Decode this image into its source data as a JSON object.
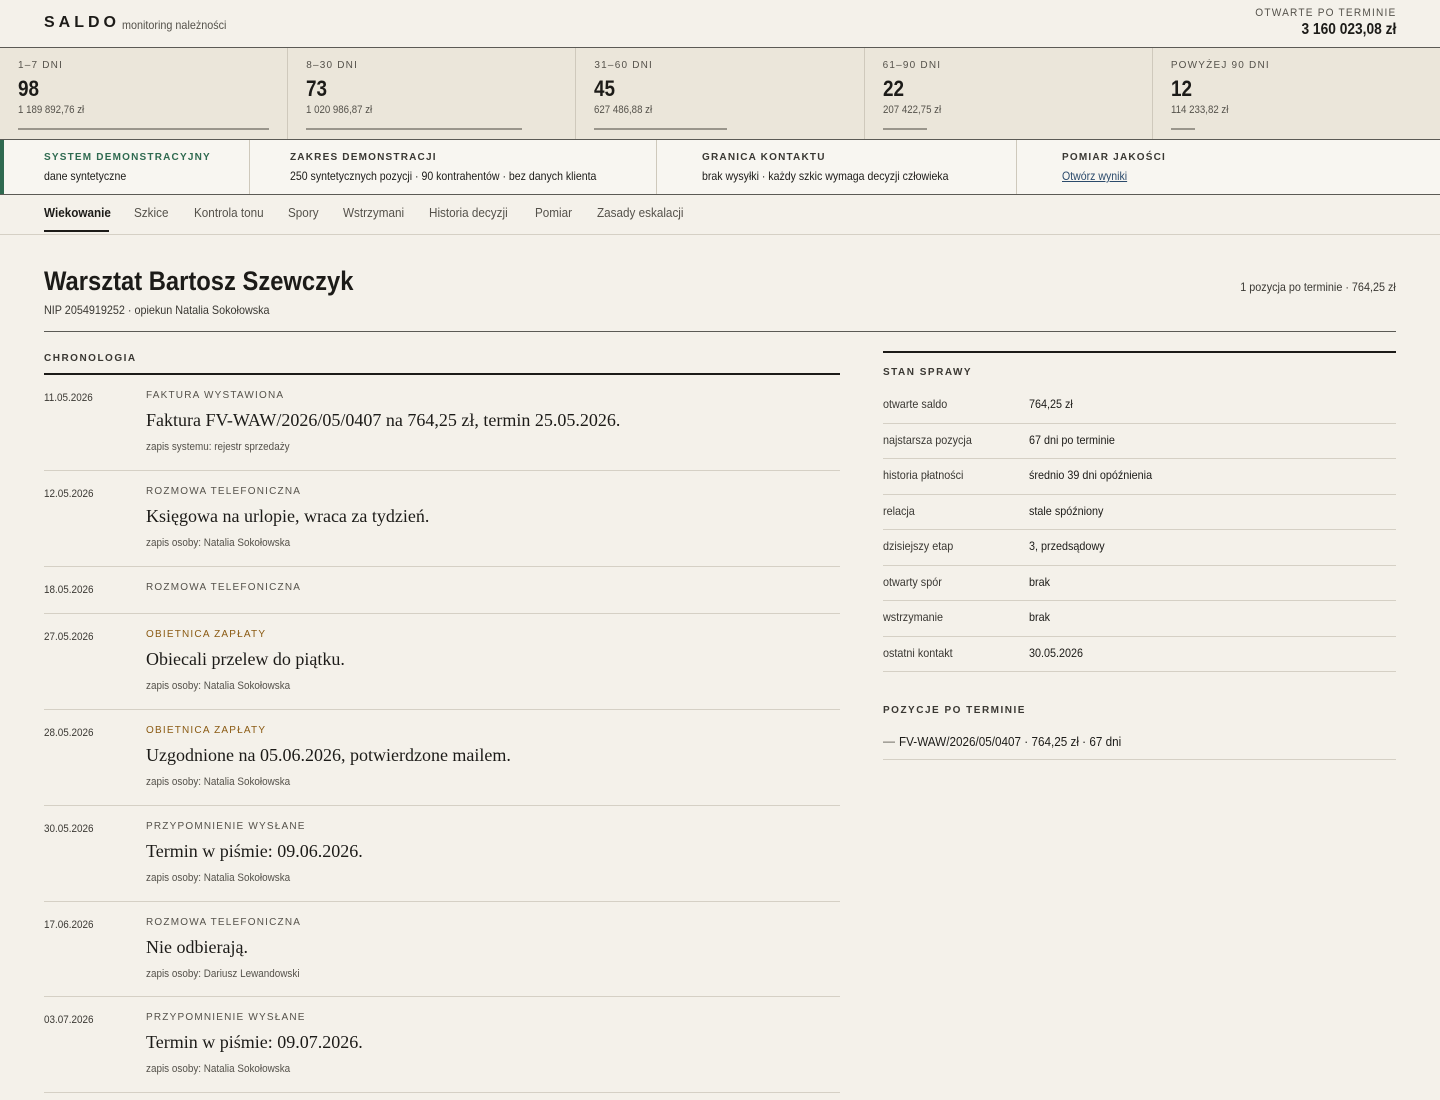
{
  "header": {
    "brand": "SALDO",
    "subtitle": "monitoring należności",
    "open_label": "OTWARTE PO TERMINIE",
    "open_value": "3 160 023,08 zł"
  },
  "buckets": [
    {
      "label": "1–7 DNI",
      "count": "98",
      "amount": "1 189 892,76 zł",
      "share": 0.376
    },
    {
      "label": "8–30 DNI",
      "count": "73",
      "amount": "1 020 986,87 zł",
      "share": 0.323
    },
    {
      "label": "31–60 DNI",
      "count": "45",
      "amount": "627 486,88 zł",
      "share": 0.199
    },
    {
      "label": "61–90 DNI",
      "count": "22",
      "amount": "207 422,75 zł",
      "share": 0.066
    },
    {
      "label": "POWYŻEJ 90 DNI",
      "count": "12",
      "amount": "114 233,82 zł",
      "share": 0.036
    }
  ],
  "info": {
    "system_label": "SYSTEM DEMONSTRACYJNY",
    "system_value": "dane syntetyczne",
    "scope_label": "ZAKRES DEMONSTRACJI",
    "scope_value": "250 syntetycznych pozycji · 90 kontrahentów · bez danych klienta",
    "contact_label": "GRANICA KONTAKTU",
    "contact_value": "brak wysyłki · każdy szkic wymaga decyzji człowieka",
    "quality_label": "POMIAR JAKOŚCI",
    "quality_link": "Otwórz wyniki"
  },
  "tabs": [
    "Wiekowanie",
    "Szkice",
    "Kontrola tonu",
    "Spory",
    "Wstrzymani",
    "Historia decyzji",
    "Pomiar",
    "Zasady eskalacji"
  ],
  "entity": {
    "name": "Warsztat Bartosz Szewczyk",
    "meta": "NIP 2054919252 · opiekun Natalia Sokołowska",
    "summary": "1 pozycja po terminie · 764,25 zł"
  },
  "chronology": {
    "title": "CHRONOLOGIA",
    "events": [
      {
        "date": "11.05.2026",
        "type": "FAKTURA WYSTAWIONA",
        "text": "Faktura FV-WAW/2026/05/0407 na 764,25 zł, termin 25.05.2026.",
        "note": "zapis systemu: rejestr sprzedaży"
      },
      {
        "date": "12.05.2026",
        "type": "ROZMOWA TELEFONICZNA",
        "text": "Księgowa na urlopie, wraca za tydzień.",
        "note": "zapis osoby: Natalia Sokołowska"
      },
      {
        "date": "18.05.2026",
        "type": "ROZMOWA TELEFONICZNA",
        "text": "",
        "note": ""
      },
      {
        "date": "27.05.2026",
        "type": "OBIETNICA ZAPŁATY",
        "text": "Obiecali przelew do piątku.",
        "note": "zapis osoby: Natalia Sokołowska"
      },
      {
        "date": "28.05.2026",
        "type": "OBIETNICA ZAPŁATY",
        "text": "Uzgodnione na 05.06.2026, potwierdzone mailem.",
        "note": "zapis osoby: Natalia Sokołowska"
      },
      {
        "date": "30.05.2026",
        "type": "PRZYPOMNIENIE WYSŁANE",
        "text": "Termin w piśmie: 09.06.2026.",
        "note": "zapis osoby: Natalia Sokołowska"
      },
      {
        "date": "17.06.2026",
        "type": "ROZMOWA TELEFONICZNA",
        "text": "Nie odbierają.",
        "note": "zapis osoby: Dariusz Lewandowski"
      },
      {
        "date": "03.07.2026",
        "type": "PRZYPOMNIENIE WYSŁANE",
        "text": "Termin w piśmie: 09.07.2026.",
        "note": "zapis osoby: Natalia Sokołowska"
      }
    ]
  },
  "case": {
    "title": "STAN SPRAWY",
    "rows": [
      {
        "key": "otwarte saldo",
        "value": "764,25 zł"
      },
      {
        "key": "najstarsza pozycja",
        "value": "67 dni po terminie"
      },
      {
        "key": "historia płatności",
        "value": "średnio 39 dni opóźnienia"
      },
      {
        "key": "relacja",
        "value": "stale spóźniony"
      },
      {
        "key": "dzisiejszy etap",
        "value": "3, przedsądowy"
      },
      {
        "key": "otwarty spór",
        "value": "brak"
      },
      {
        "key": "wstrzymanie",
        "value": "brak"
      },
      {
        "key": "ostatni kontakt",
        "value": "30.05.2026"
      }
    ],
    "overdue_title": "POZYCJE PO TERMINIE",
    "overdue_items": [
      "FV-WAW/2026/05/0407 · 764,25 zł · 67 dni"
    ]
  },
  "colors": {
    "accent_green": "#2f6a50",
    "promise": "#8a5a12",
    "link": "#2b4a6b"
  }
}
